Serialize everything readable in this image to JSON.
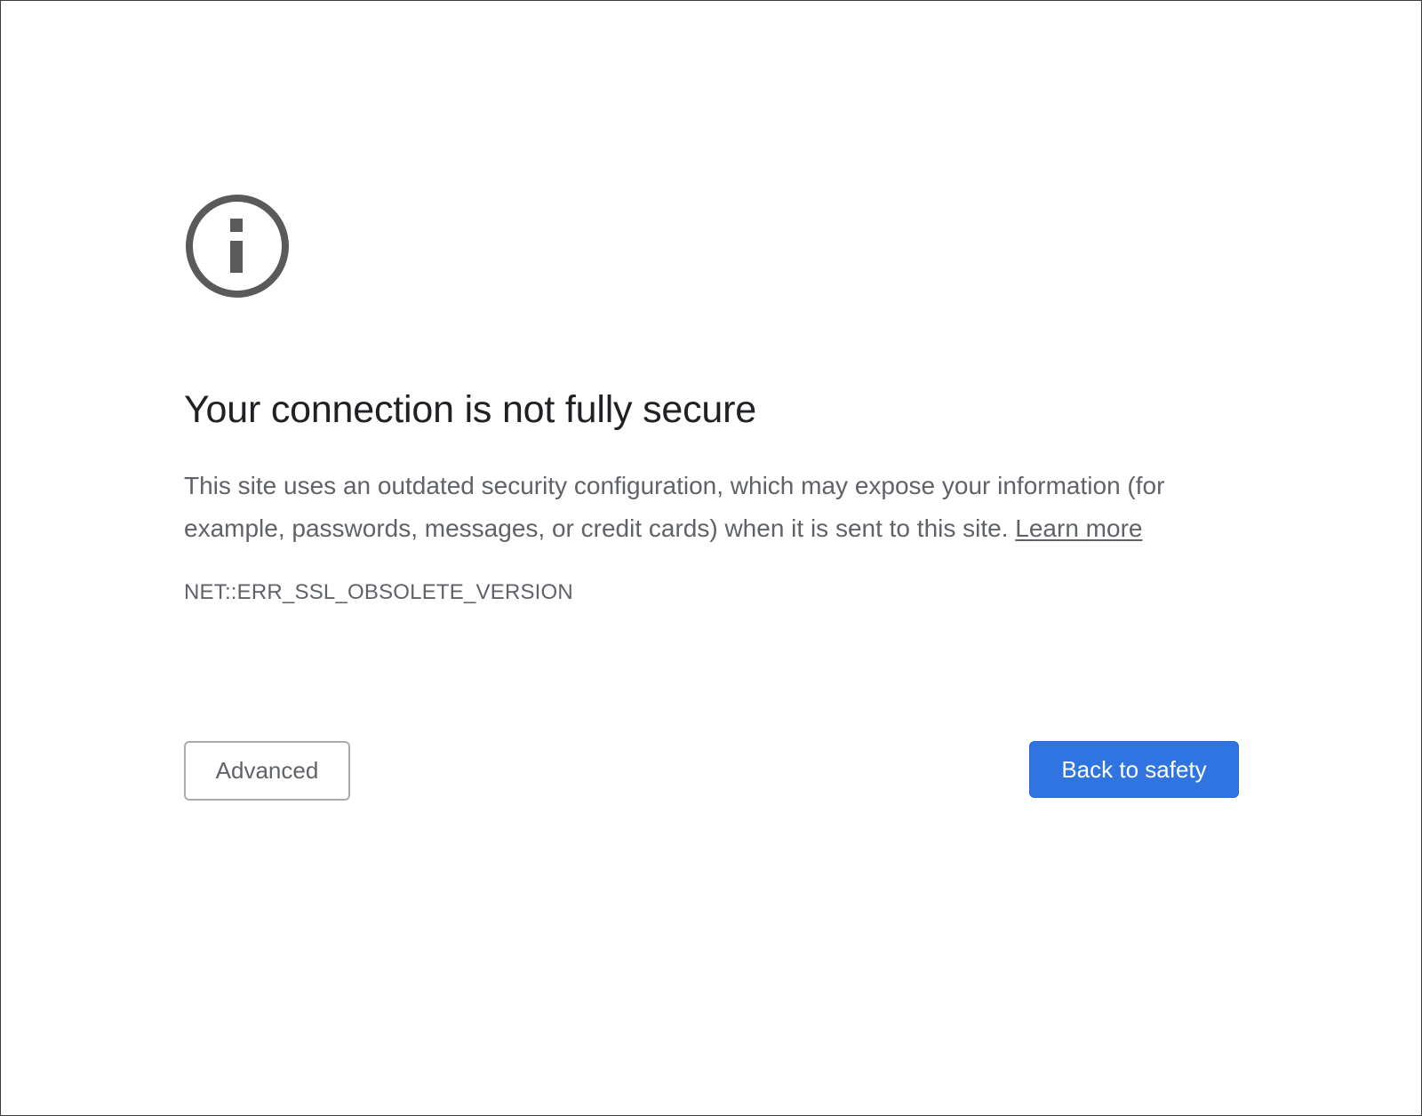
{
  "page": {
    "heading": "Your connection is not fully secure",
    "explanation": "This site uses an outdated security configuration, which may expose your information (for example, passwords, messages, or credit cards) when it is sent to this site.",
    "learn_more": "Learn more",
    "error_code": "NET::ERR_SSL_OBSOLETE_VERSION"
  },
  "buttons": {
    "advanced": "Advanced",
    "back_to_safety": "Back to safety"
  },
  "icons": {
    "status": "info-icon"
  },
  "colors": {
    "primary_button": "#2f74e0",
    "heading_text": "#202124",
    "body_text": "#5f6368",
    "icon": "#5a5a5a"
  }
}
